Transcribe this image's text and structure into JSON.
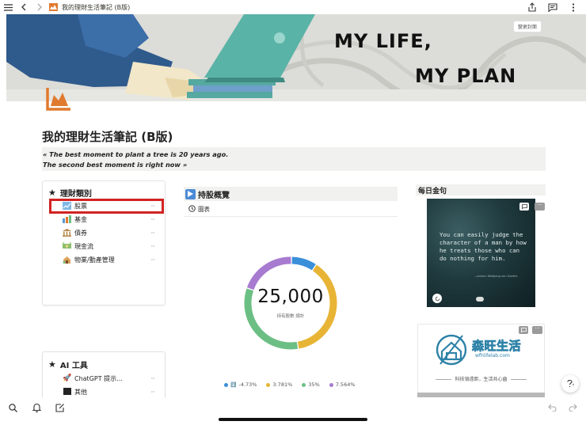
{
  "topbar": {
    "title": "我的理財生活筆記 (B版)"
  },
  "cover": {
    "line1": "MY LIFE,",
    "line2": "MY PLAN",
    "change_cover_label": "變更封面"
  },
  "page": {
    "title": "我的理財生活筆記 (B版)",
    "quote_line1": "« The best moment to plant a tree is 20 years ago.",
    "quote_line2": "The second best moment is right now »"
  },
  "categories": {
    "heading": "理財類別",
    "items": [
      {
        "label": "股票",
        "icon": "stock-chart-icon"
      },
      {
        "label": "基金",
        "icon": "fund-icon"
      },
      {
        "label": "債券",
        "icon": "bank-icon"
      },
      {
        "label": "現金流",
        "icon": "money-flow-icon"
      },
      {
        "label": "物業/動產管理",
        "icon": "property-icon"
      }
    ]
  },
  "ai_tools": {
    "heading": "AI 工具",
    "items": [
      {
        "label": "ChatGPT 提示...",
        "icon": "rocket-icon"
      },
      {
        "label": "其他",
        "icon": "black-square-icon"
      }
    ]
  },
  "holdings": {
    "heading": "持股概覽",
    "view_tab": "圖表",
    "total": "25,000",
    "total_label": "持有股數 總計",
    "legend": [
      {
        "label": "-4.73%",
        "prefix": "⬇️",
        "color": "#3b8fd9"
      },
      {
        "label": "3.781%",
        "color": "#e8b436"
      },
      {
        "label": "35%",
        "color": "#6cbf84"
      },
      {
        "label": "7.564%",
        "color": "#a77bd0"
      }
    ],
    "slices": [
      {
        "color": "#3b8fd9",
        "fraction": 0.09
      },
      {
        "color": "#e8b436",
        "fraction": 0.38
      },
      {
        "color": "#6cbf84",
        "fraction": 0.33
      },
      {
        "color": "#a77bd0",
        "fraction": 0.2
      }
    ]
  },
  "daily_quote": {
    "heading": "每日金句",
    "text": "You can easily judge the character of a man by how he treats those who can do nothing for him.",
    "author": "—Johann Wolfgang von Goethe"
  },
  "logo": {
    "title": "森旺生活",
    "url": "wfhlifelab.com",
    "slogan": "科技領遠距，生活共心齒"
  }
}
